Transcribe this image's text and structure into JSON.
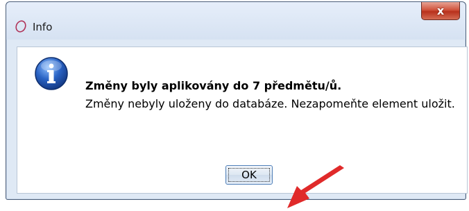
{
  "window": {
    "title": "Info"
  },
  "buttons": {
    "close_label": "x",
    "ok_label": "OK"
  },
  "message": {
    "title": "Změny byly aplikovány do 7 předmětu/ů.",
    "text": "Změny nebyly uloženy do databáze. Nezapomeňte element uložit."
  },
  "icons": {
    "app": "oval-ring-icon",
    "info": "info-icon",
    "annotation": "red-arrow-icon"
  },
  "colors": {
    "close_red": "#c9442d",
    "info_blue": "#2a63c4",
    "arrow_red": "#e02a2a"
  }
}
